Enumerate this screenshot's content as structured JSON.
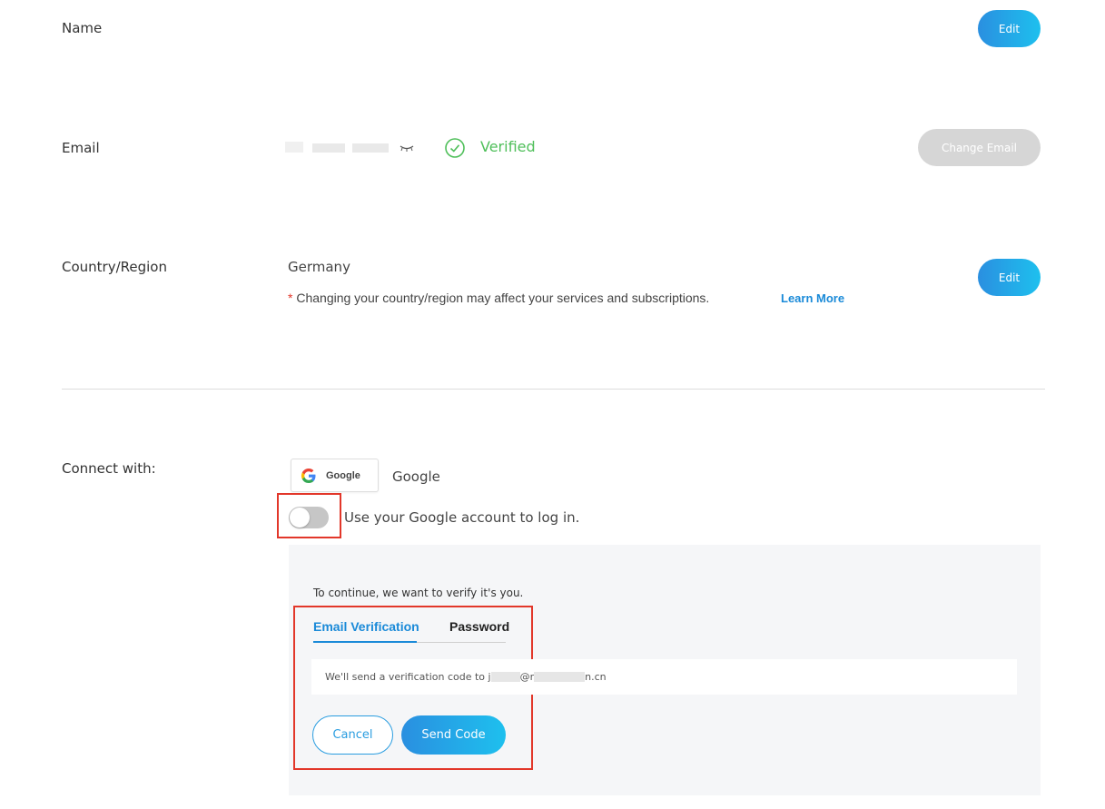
{
  "rows": {
    "name": {
      "label": "Name",
      "edit_label": "Edit"
    },
    "email": {
      "label": "Email",
      "status": "Verified",
      "change_label": "Change Email"
    },
    "country": {
      "label": "Country/Region",
      "value": "Germany",
      "note_star": "*",
      "note": "Changing your country/region may affect your services and subscriptions.",
      "learn_more": "Learn More",
      "edit_label": "Edit"
    }
  },
  "connect": {
    "label": "Connect with:",
    "google_logo_text": "Google",
    "provider_name": "Google",
    "toggle_label": "Use your Google account to log in.",
    "toggle_on": false
  },
  "verify": {
    "intro": "To continue, we want to verify it's you.",
    "tabs": [
      {
        "label": "Email Verification",
        "active": true
      },
      {
        "label": "Password",
        "active": false
      }
    ],
    "info_prefix": "We'll send a verification code to j",
    "info_mid": "@r",
    "info_suffix": "n.cn",
    "cancel_label": "Cancel",
    "send_label": "Send Code"
  },
  "colors": {
    "accent": "#1a8ad8",
    "verified": "#4fbf5a",
    "highlight": "#e2372a"
  }
}
